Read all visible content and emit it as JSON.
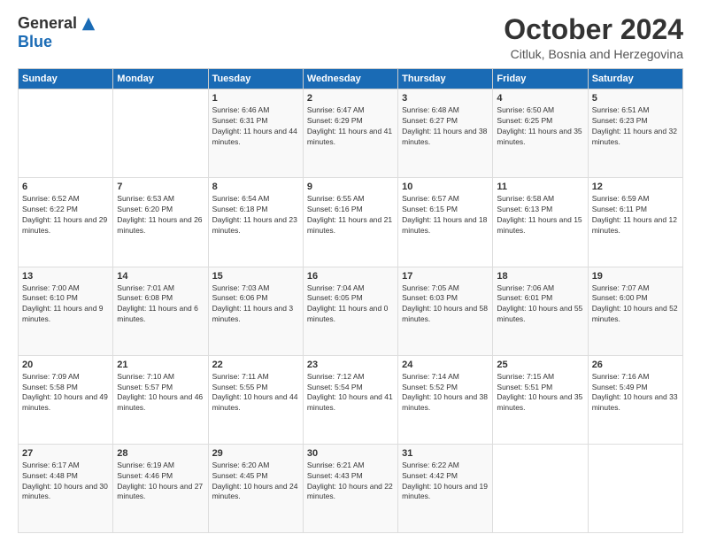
{
  "header": {
    "logo_general": "General",
    "logo_blue": "Blue",
    "month_title": "October 2024",
    "location": "Citluk, Bosnia and Herzegovina"
  },
  "days_of_week": [
    "Sunday",
    "Monday",
    "Tuesday",
    "Wednesday",
    "Thursday",
    "Friday",
    "Saturday"
  ],
  "weeks": [
    [
      {
        "day": "",
        "detail": ""
      },
      {
        "day": "",
        "detail": ""
      },
      {
        "day": "1",
        "detail": "Sunrise: 6:46 AM\nSunset: 6:31 PM\nDaylight: 11 hours and 44 minutes."
      },
      {
        "day": "2",
        "detail": "Sunrise: 6:47 AM\nSunset: 6:29 PM\nDaylight: 11 hours and 41 minutes."
      },
      {
        "day": "3",
        "detail": "Sunrise: 6:48 AM\nSunset: 6:27 PM\nDaylight: 11 hours and 38 minutes."
      },
      {
        "day": "4",
        "detail": "Sunrise: 6:50 AM\nSunset: 6:25 PM\nDaylight: 11 hours and 35 minutes."
      },
      {
        "day": "5",
        "detail": "Sunrise: 6:51 AM\nSunset: 6:23 PM\nDaylight: 11 hours and 32 minutes."
      }
    ],
    [
      {
        "day": "6",
        "detail": "Sunrise: 6:52 AM\nSunset: 6:22 PM\nDaylight: 11 hours and 29 minutes."
      },
      {
        "day": "7",
        "detail": "Sunrise: 6:53 AM\nSunset: 6:20 PM\nDaylight: 11 hours and 26 minutes."
      },
      {
        "day": "8",
        "detail": "Sunrise: 6:54 AM\nSunset: 6:18 PM\nDaylight: 11 hours and 23 minutes."
      },
      {
        "day": "9",
        "detail": "Sunrise: 6:55 AM\nSunset: 6:16 PM\nDaylight: 11 hours and 21 minutes."
      },
      {
        "day": "10",
        "detail": "Sunrise: 6:57 AM\nSunset: 6:15 PM\nDaylight: 11 hours and 18 minutes."
      },
      {
        "day": "11",
        "detail": "Sunrise: 6:58 AM\nSunset: 6:13 PM\nDaylight: 11 hours and 15 minutes."
      },
      {
        "day": "12",
        "detail": "Sunrise: 6:59 AM\nSunset: 6:11 PM\nDaylight: 11 hours and 12 minutes."
      }
    ],
    [
      {
        "day": "13",
        "detail": "Sunrise: 7:00 AM\nSunset: 6:10 PM\nDaylight: 11 hours and 9 minutes."
      },
      {
        "day": "14",
        "detail": "Sunrise: 7:01 AM\nSunset: 6:08 PM\nDaylight: 11 hours and 6 minutes."
      },
      {
        "day": "15",
        "detail": "Sunrise: 7:03 AM\nSunset: 6:06 PM\nDaylight: 11 hours and 3 minutes."
      },
      {
        "day": "16",
        "detail": "Sunrise: 7:04 AM\nSunset: 6:05 PM\nDaylight: 11 hours and 0 minutes."
      },
      {
        "day": "17",
        "detail": "Sunrise: 7:05 AM\nSunset: 6:03 PM\nDaylight: 10 hours and 58 minutes."
      },
      {
        "day": "18",
        "detail": "Sunrise: 7:06 AM\nSunset: 6:01 PM\nDaylight: 10 hours and 55 minutes."
      },
      {
        "day": "19",
        "detail": "Sunrise: 7:07 AM\nSunset: 6:00 PM\nDaylight: 10 hours and 52 minutes."
      }
    ],
    [
      {
        "day": "20",
        "detail": "Sunrise: 7:09 AM\nSunset: 5:58 PM\nDaylight: 10 hours and 49 minutes."
      },
      {
        "day": "21",
        "detail": "Sunrise: 7:10 AM\nSunset: 5:57 PM\nDaylight: 10 hours and 46 minutes."
      },
      {
        "day": "22",
        "detail": "Sunrise: 7:11 AM\nSunset: 5:55 PM\nDaylight: 10 hours and 44 minutes."
      },
      {
        "day": "23",
        "detail": "Sunrise: 7:12 AM\nSunset: 5:54 PM\nDaylight: 10 hours and 41 minutes."
      },
      {
        "day": "24",
        "detail": "Sunrise: 7:14 AM\nSunset: 5:52 PM\nDaylight: 10 hours and 38 minutes."
      },
      {
        "day": "25",
        "detail": "Sunrise: 7:15 AM\nSunset: 5:51 PM\nDaylight: 10 hours and 35 minutes."
      },
      {
        "day": "26",
        "detail": "Sunrise: 7:16 AM\nSunset: 5:49 PM\nDaylight: 10 hours and 33 minutes."
      }
    ],
    [
      {
        "day": "27",
        "detail": "Sunrise: 6:17 AM\nSunset: 4:48 PM\nDaylight: 10 hours and 30 minutes."
      },
      {
        "day": "28",
        "detail": "Sunrise: 6:19 AM\nSunset: 4:46 PM\nDaylight: 10 hours and 27 minutes."
      },
      {
        "day": "29",
        "detail": "Sunrise: 6:20 AM\nSunset: 4:45 PM\nDaylight: 10 hours and 24 minutes."
      },
      {
        "day": "30",
        "detail": "Sunrise: 6:21 AM\nSunset: 4:43 PM\nDaylight: 10 hours and 22 minutes."
      },
      {
        "day": "31",
        "detail": "Sunrise: 6:22 AM\nSunset: 4:42 PM\nDaylight: 10 hours and 19 minutes."
      },
      {
        "day": "",
        "detail": ""
      },
      {
        "day": "",
        "detail": ""
      }
    ]
  ]
}
